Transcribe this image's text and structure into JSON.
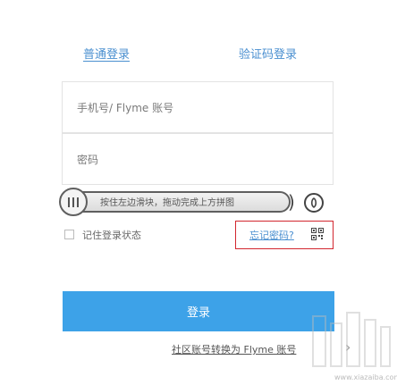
{
  "tabs": {
    "normal_login": "普通登录",
    "code_login": "验证码登录"
  },
  "form": {
    "account_placeholder": "手机号/ Flyme 账号",
    "password_placeholder": "密码"
  },
  "slider": {
    "hint": "按住左边滑块，拖动完成上方拼图"
  },
  "options": {
    "remember_label": "记住登录状态",
    "forgot_label": "忘记密码?"
  },
  "actions": {
    "login_label": "登录",
    "community_label": "社区账号转换为 Flyme 账号"
  },
  "watermark": {
    "url": "www.xiazaiba.com"
  },
  "colors": {
    "accent": "#3da2e8",
    "link": "#4a8fd0",
    "highlight_box": "#d2262e"
  }
}
